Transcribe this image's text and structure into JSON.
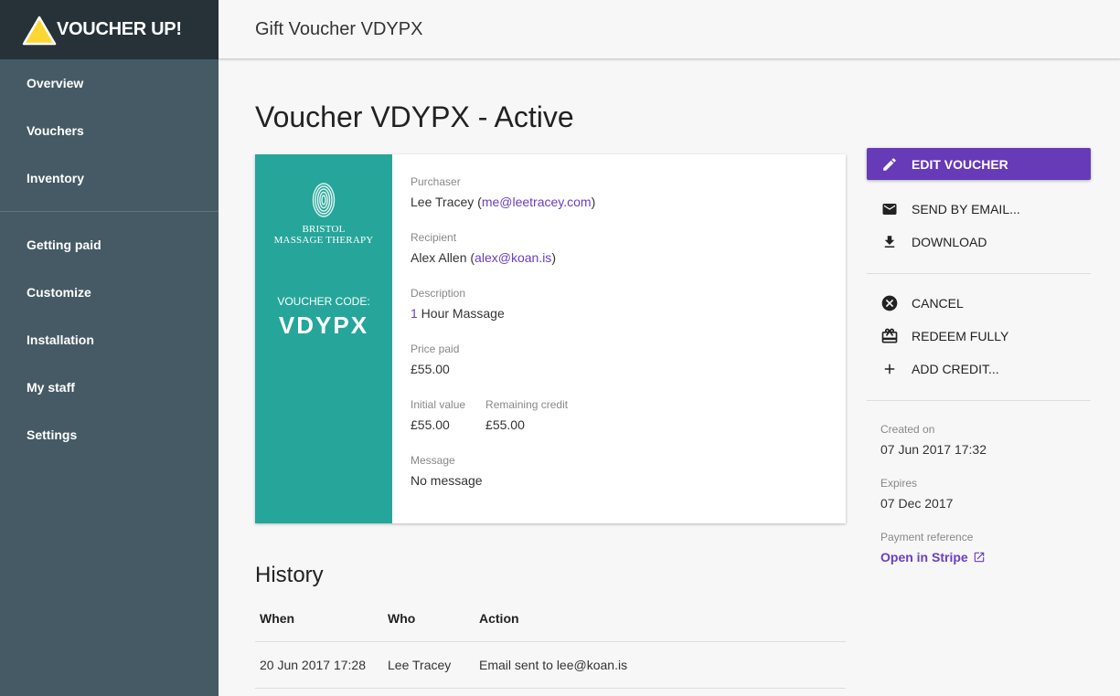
{
  "brand": {
    "name": "VOUCHER UP!"
  },
  "sidebar": {
    "items_top": [
      {
        "label": "Overview"
      },
      {
        "label": "Vouchers"
      },
      {
        "label": "Inventory"
      }
    ],
    "items_bottom": [
      {
        "label": "Getting paid"
      },
      {
        "label": "Customize"
      },
      {
        "label": "Installation"
      },
      {
        "label": "My staff"
      },
      {
        "label": "Settings"
      }
    ]
  },
  "topbar": {
    "title": "Gift Voucher VDYPX"
  },
  "page": {
    "title": "Voucher VDYPX - Active"
  },
  "voucher": {
    "business_line1": "BRISTOL",
    "business_line2": "MASSAGE THERAPY",
    "code_label": "VOUCHER CODE:",
    "code": "VDYPX",
    "purchaser_label": "Purchaser",
    "purchaser_name": "Lee Tracey (",
    "purchaser_email": "me@leetracey.com",
    "purchaser_close": ")",
    "recipient_label": "Recipient",
    "recipient_name": "Alex Allen (",
    "recipient_email": "alex@koan.is",
    "recipient_close": ")",
    "description_label": "Description",
    "description_qty": "1",
    "description_value": " Hour Massage",
    "price_label": "Price paid",
    "price_value": "£55.00",
    "initial_label": "Initial value",
    "initial_value": "£55.00",
    "remaining_label": "Remaining credit",
    "remaining_value": "£55.00",
    "message_label": "Message",
    "message_value": "No message"
  },
  "history": {
    "title": "History",
    "columns": {
      "when": "When",
      "who": "Who",
      "action": "Action"
    },
    "rows": [
      {
        "when": "20 Jun 2017 17:28",
        "who": "Lee Tracey",
        "action": "Email sent to lee@koan.is"
      }
    ]
  },
  "actions": {
    "edit": "EDIT VOUCHER",
    "send_email": "SEND BY EMAIL...",
    "download": "DOWNLOAD",
    "cancel": "CANCEL",
    "redeem": "REDEEM FULLY",
    "add_credit": "ADD CREDIT..."
  },
  "meta": {
    "created_label": "Created on",
    "created_value": "07 Jun 2017 17:32",
    "expires_label": "Expires",
    "expires_value": "07 Dec 2017",
    "payment_label": "Payment reference",
    "payment_link": "Open in Stripe"
  },
  "colors": {
    "sidebar": "#455a64",
    "brand_bar": "#263238",
    "accent": "#673ab7",
    "voucher_teal": "#26a69a",
    "logo_yellow": "#fdd835"
  }
}
